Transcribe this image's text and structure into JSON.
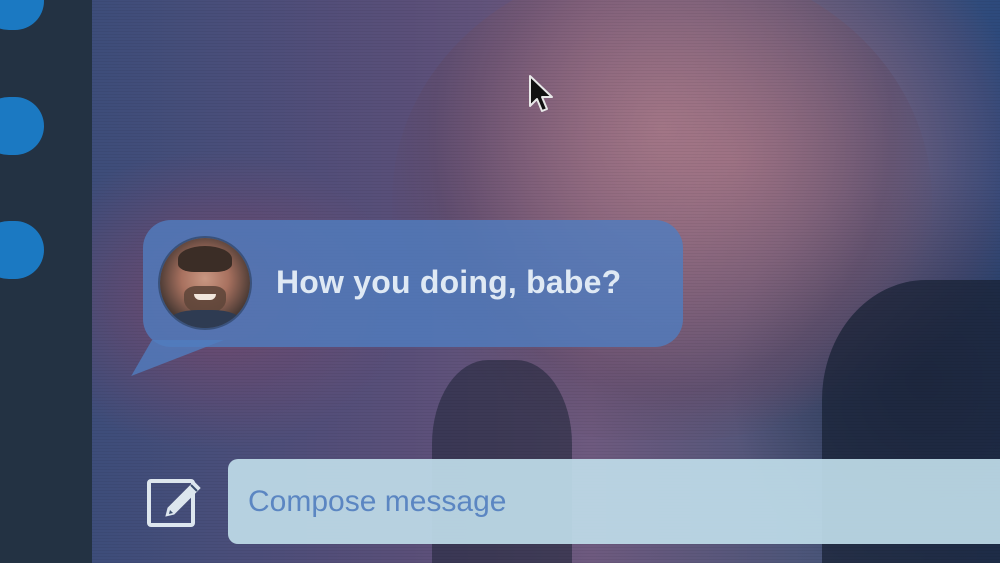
{
  "chat": {
    "message_text": "How you doing, babe?",
    "avatar": "contact-avatar"
  },
  "composer": {
    "placeholder": "Compose message",
    "icon": "compose-icon"
  },
  "cursor": {
    "icon": "mouse-pointer-icon"
  },
  "colors": {
    "bubble": "#507dbe",
    "sidebar_accent": "#1b79c2",
    "compose_field": "#bedce8",
    "placeholder_text": "#5b86c2",
    "message_text": "#dfe9f4"
  }
}
